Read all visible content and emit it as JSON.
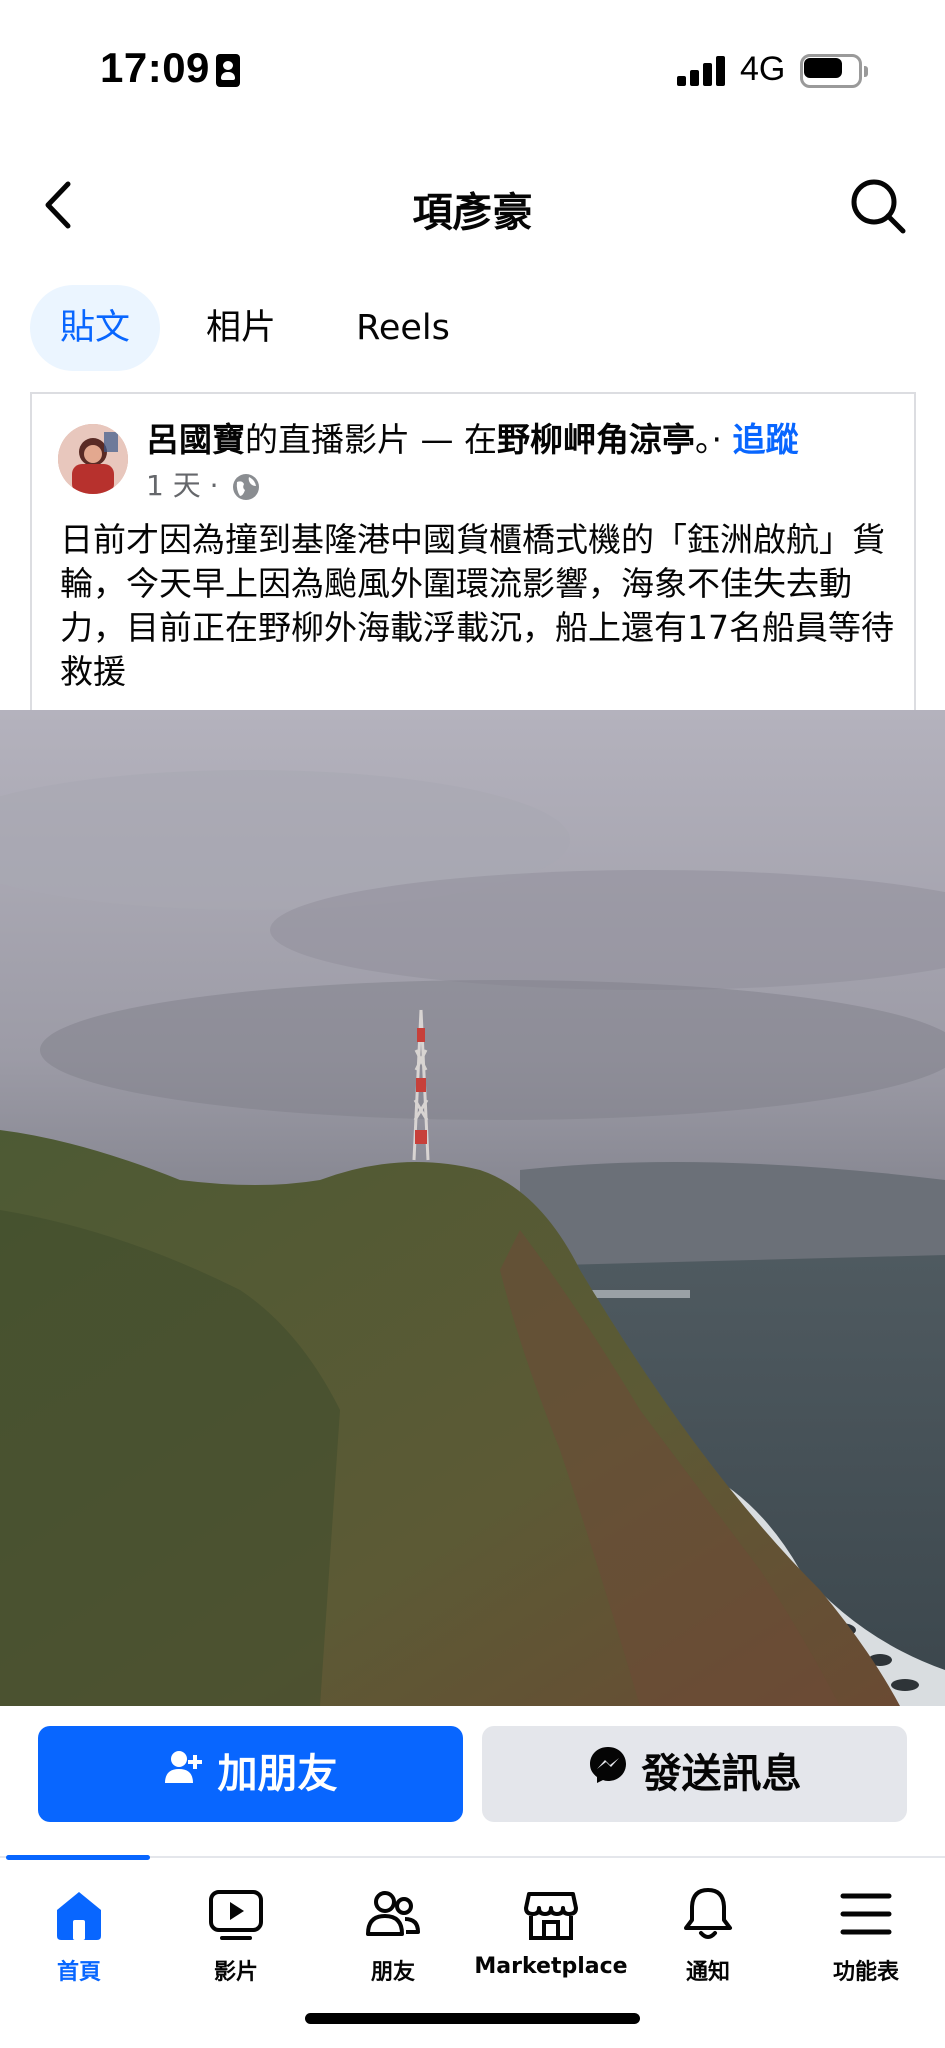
{
  "status_bar": {
    "time": "17:09",
    "network": "4G",
    "signal_icon": "cellular-signal-icon",
    "battery_icon": "battery-icon",
    "id_icon": "contact-card-icon"
  },
  "header": {
    "title": "項彥豪",
    "back_icon": "chevron-left-icon",
    "search_icon": "search-icon"
  },
  "tabs": [
    {
      "label": "貼文",
      "active": true
    },
    {
      "label": "相片",
      "active": false
    },
    {
      "label": "Reels",
      "active": false
    }
  ],
  "post": {
    "author": "呂國寶",
    "action_text": "的直播影片 — 在",
    "location": "野柳岬角涼亭",
    "punct": "。·",
    "follow_label": "追蹤",
    "time_ago": "1 天 ·",
    "privacy_icon": "globe-icon",
    "body": "日前才因為撞到基隆港中國貨櫃橋式機的「鈺洲啟航」貨輪，今天早上因為颱風外圍環流影響，海象不佳失去動力，目前正在野柳外海載浮載沉，船上還有17名船員等待救援"
  },
  "actions": {
    "add_friend_label": "加朋友",
    "add_friend_icon": "add-person-icon",
    "message_label": "發送訊息",
    "message_icon": "messenger-icon"
  },
  "bottom_nav": [
    {
      "label": "首頁",
      "icon": "home-icon",
      "active": true
    },
    {
      "label": "影片",
      "icon": "video-icon",
      "active": false
    },
    {
      "label": "朋友",
      "icon": "friends-icon",
      "active": false
    },
    {
      "label": "Marketplace",
      "icon": "marketplace-icon",
      "active": false
    },
    {
      "label": "通知",
      "icon": "bell-icon",
      "active": false
    },
    {
      "label": "功能表",
      "icon": "menu-icon",
      "active": false
    }
  ],
  "colors": {
    "accent": "#0866ff",
    "tab_active_bg": "#ebf5ff",
    "secondary_button": "#e4e6eb",
    "meta_text": "#65676b"
  }
}
